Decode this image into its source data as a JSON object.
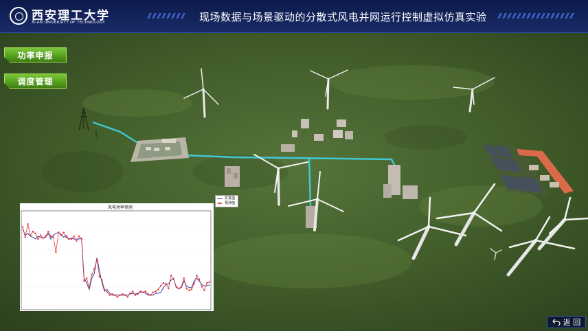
{
  "header": {
    "university_name_cn": "西安理工大学",
    "university_name_en": "XI'AN UNIVERSITY OF TECHNOLOGY",
    "title": "现场数据与场景驱动的分散式风电并网运行控制虚拟仿真实验"
  },
  "menu": {
    "power_report_label": "功率申报",
    "dispatch_manage_label": "调度管理"
  },
  "chart": {
    "title": "风电功率预测",
    "legend_actual": "实发值",
    "legend_predicted": "预测值"
  },
  "footer": {
    "back_label": "返 回"
  },
  "colors": {
    "header_bg": "#14245c",
    "button_green": "#56a21f",
    "line_actual": "#3a3aa8",
    "line_predicted": "#e03b3b",
    "cable": "#3fd3e8"
  },
  "chart_data": {
    "type": "line",
    "title": "风电功率预测",
    "series": [
      {
        "name": "实发值",
        "values": [
          0.83,
          0.76,
          0.78,
          0.75,
          0.74,
          0.72,
          0.75,
          0.74,
          0.73,
          0.74,
          0.78,
          0.72,
          0.76,
          0.78,
          0.79,
          0.77,
          0.74,
          0.76,
          0.72,
          0.73,
          0.72,
          0.72,
          0.72,
          0.73,
          0.3,
          0.25,
          0.18,
          0.3,
          0.35,
          0.52,
          0.38,
          0.25,
          0.16,
          0.18,
          0.14,
          0.12,
          0.12,
          0.12,
          0.12,
          0.12,
          0.12,
          0.12,
          0.13,
          0.14,
          0.13,
          0.14,
          0.15,
          0.15,
          0.14,
          0.12,
          0.12,
          0.12,
          0.14,
          0.14,
          0.15,
          0.2,
          0.23,
          0.24,
          0.28,
          0.3,
          0.2,
          0.19,
          0.2,
          0.27,
          0.22,
          0.2,
          0.2,
          0.27,
          0.3,
          0.27,
          0.23,
          0.22,
          0.22,
          0.23
        ]
      },
      {
        "name": "预测值",
        "values": [
          0.85,
          0.74,
          0.88,
          0.76,
          0.8,
          0.78,
          0.72,
          0.76,
          0.73,
          0.75,
          0.8,
          0.75,
          0.74,
          0.58,
          0.79,
          0.76,
          0.79,
          0.74,
          0.72,
          0.72,
          0.75,
          0.7,
          0.75,
          0.72,
          0.27,
          0.3,
          0.2,
          0.34,
          0.4,
          0.5,
          0.32,
          0.28,
          0.18,
          0.15,
          0.12,
          0.13,
          0.12,
          0.1,
          0.12,
          0.13,
          0.12,
          0.1,
          0.14,
          0.16,
          0.12,
          0.13,
          0.16,
          0.15,
          0.16,
          0.13,
          0.12,
          0.15,
          0.16,
          0.18,
          0.22,
          0.25,
          0.24,
          0.19,
          0.33,
          0.29,
          0.21,
          0.19,
          0.21,
          0.3,
          0.19,
          0.17,
          0.18,
          0.24,
          0.33,
          0.29,
          0.21,
          0.17,
          0.25,
          0.26
        ]
      }
    ],
    "ylim": [
      0,
      1
    ]
  }
}
